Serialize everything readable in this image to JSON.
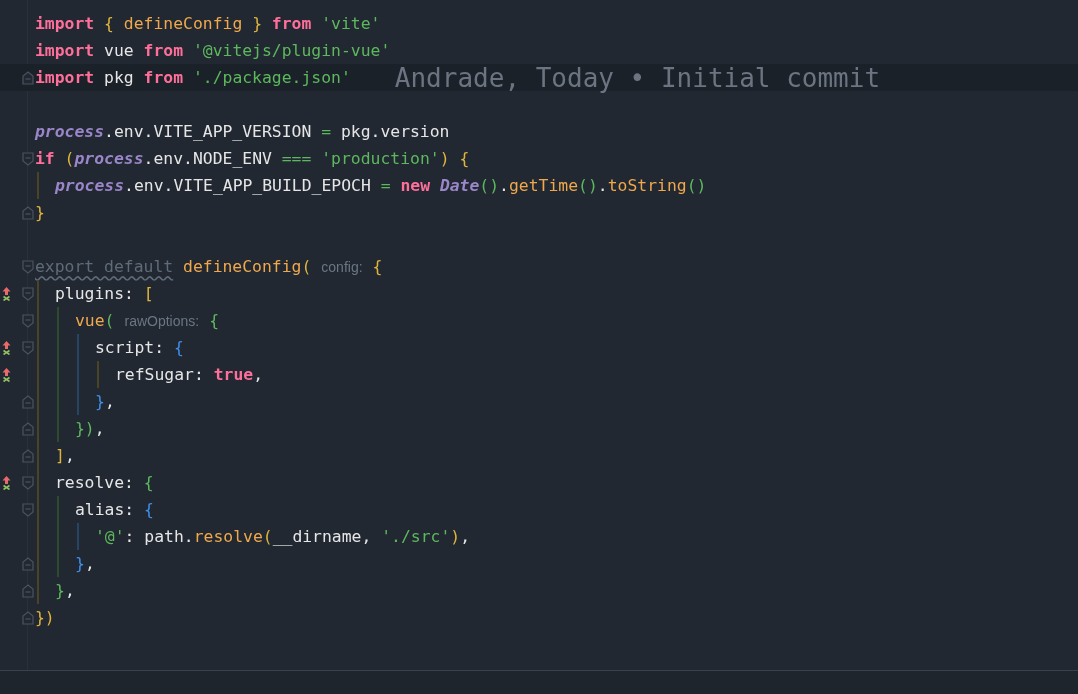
{
  "editor": {
    "lines": [
      {
        "kind": "code",
        "segments": [
          {
            "kind": "code",
            "tokens": [
              {
                "kind": "kw",
                "text": "import"
              },
              {
                "kind": "b1",
                "text": " {"
              },
              {
                "kind": "fn",
                "text": " defineConfig "
              },
              {
                "kind": "b1",
                "text": "}"
              },
              {
                "kind": "kw",
                "text": " from"
              },
              {
                "kind": "str",
                "text": " 'vite'"
              }
            ]
          }
        ]
      },
      {
        "kind": "code",
        "segments": [
          {
            "kind": "code",
            "tokens": [
              {
                "kind": "kw",
                "text": "import"
              },
              {
                "kind": "plain",
                "text": " vue "
              },
              {
                "kind": "kw",
                "text": "from"
              },
              {
                "kind": "str",
                "text": " '@vitejs/plugin-vue'"
              }
            ]
          }
        ]
      },
      {
        "kind": "code",
        "current": true,
        "fold_end": true,
        "blame": "Andrade, Today • Initial commit",
        "segments": [
          {
            "kind": "code",
            "tokens": [
              {
                "kind": "kw",
                "text": "import"
              },
              {
                "kind": "plain",
                "text": " pkg "
              },
              {
                "kind": "kw",
                "text": "from"
              },
              {
                "kind": "str",
                "text": " './package.json'"
              }
            ]
          }
        ]
      },
      {
        "kind": "blank"
      },
      {
        "kind": "code",
        "segments": [
          {
            "kind": "code",
            "tokens": [
              {
                "kind": "obj",
                "text": "process"
              },
              {
                "kind": "plain",
                "text": ".env.VITE_APP_VERSION "
              },
              {
                "kind": "op",
                "text": "="
              },
              {
                "kind": "plain",
                "text": " pkg.version"
              }
            ]
          }
        ]
      },
      {
        "kind": "code",
        "fold_start": true,
        "segments": [
          {
            "kind": "code",
            "tokens": [
              {
                "kind": "kw",
                "text": "if"
              },
              {
                "kind": "b1",
                "text": " ("
              },
              {
                "kind": "obj",
                "text": "process"
              },
              {
                "kind": "plain",
                "text": ".env.NODE_ENV "
              },
              {
                "kind": "op",
                "text": "==="
              },
              {
                "kind": "str",
                "text": " 'production'"
              },
              {
                "kind": "b1",
                "text": ")"
              },
              {
                "kind": "b1",
                "text": " {"
              }
            ]
          }
        ],
        "children": [
          {
            "kind": "code",
            "segments": [
              {
                "kind": "code",
                "tokens": [
                  {
                    "kind": "obj",
                    "text": "process"
                  },
                  {
                    "kind": "plain",
                    "text": ".env.VITE_APP_BUILD_EPOCH "
                  },
                  {
                    "kind": "op",
                    "text": "="
                  },
                  {
                    "kind": "kw",
                    "text": " new"
                  },
                  {
                    "kind": "obj",
                    "text": " Date"
                  },
                  {
                    "kind": "b2",
                    "text": "()"
                  },
                  {
                    "kind": "plain",
                    "text": "."
                  },
                  {
                    "kind": "fn",
                    "text": "getTime"
                  },
                  {
                    "kind": "b2",
                    "text": "()"
                  },
                  {
                    "kind": "plain",
                    "text": "."
                  },
                  {
                    "kind": "fn",
                    "text": "toString"
                  },
                  {
                    "kind": "b2",
                    "text": "()"
                  }
                ]
              }
            ]
          }
        ]
      },
      {
        "kind": "code",
        "fold_end": true,
        "segments": [
          {
            "kind": "code",
            "tokens": [
              {
                "kind": "b1",
                "text": "}"
              }
            ]
          }
        ]
      },
      {
        "kind": "blank"
      },
      {
        "kind": "code",
        "fold_start": true,
        "segments": [
          {
            "kind": "code",
            "tokens": [
              {
                "kind": "dim",
                "text": "export default"
              },
              {
                "kind": "fn",
                "text": " defineConfig"
              },
              {
                "kind": "b1",
                "text": "("
              }
            ]
          },
          {
            "kind": "hint",
            "text": "config:"
          },
          {
            "kind": "code",
            "tokens": [
              {
                "kind": "b1",
                "text": "{"
              }
            ]
          }
        ],
        "children": [
          {
            "kind": "code",
            "change": true,
            "fold_start": true,
            "segments": [
              {
                "kind": "code",
                "tokens": [
                  {
                    "kind": "plain",
                    "text": "plugins: "
                  },
                  {
                    "kind": "b1",
                    "text": "["
                  }
                ]
              }
            ],
            "children": [
              {
                "kind": "code",
                "fold_start": true,
                "segments": [
                  {
                    "kind": "code",
                    "tokens": [
                      {
                        "kind": "fn",
                        "text": "vue"
                      },
                      {
                        "kind": "b2",
                        "text": "("
                      }
                    ]
                  },
                  {
                    "kind": "hint",
                    "text": "rawOptions:"
                  },
                  {
                    "kind": "code",
                    "tokens": [
                      {
                        "kind": "b2",
                        "text": "{"
                      }
                    ]
                  }
                ],
                "children": [
                  {
                    "kind": "code",
                    "change": true,
                    "fold_start": true,
                    "segments": [
                      {
                        "kind": "code",
                        "tokens": [
                          {
                            "kind": "plain",
                            "text": "script: "
                          },
                          {
                            "kind": "b3",
                            "text": "{"
                          }
                        ]
                      }
                    ],
                    "children": [
                      {
                        "kind": "code",
                        "change": true,
                        "segments": [
                          {
                            "kind": "code",
                            "tokens": [
                              {
                                "kind": "plain",
                                "text": "refSugar: "
                              },
                              {
                                "kind": "kw",
                                "text": "true"
                              },
                              {
                                "kind": "plain",
                                "text": ","
                              }
                            ]
                          }
                        ]
                      }
                    ]
                  },
                  {
                    "kind": "code",
                    "fold_end": true,
                    "segments": [
                      {
                        "kind": "code",
                        "tokens": [
                          {
                            "kind": "b3",
                            "text": "}"
                          },
                          {
                            "kind": "plain",
                            "text": ","
                          }
                        ]
                      }
                    ]
                  }
                ]
              },
              {
                "kind": "code",
                "fold_end": true,
                "segments": [
                  {
                    "kind": "code",
                    "tokens": [
                      {
                        "kind": "b2",
                        "text": "})"
                      },
                      {
                        "kind": "plain",
                        "text": ","
                      }
                    ]
                  }
                ]
              }
            ]
          },
          {
            "kind": "code",
            "fold_end": true,
            "segments": [
              {
                "kind": "code",
                "tokens": [
                  {
                    "kind": "b1",
                    "text": "]"
                  },
                  {
                    "kind": "plain",
                    "text": ","
                  }
                ]
              }
            ]
          },
          {
            "kind": "code",
            "change": true,
            "fold_start": true,
            "segments": [
              {
                "kind": "code",
                "tokens": [
                  {
                    "kind": "plain",
                    "text": "resolve: "
                  },
                  {
                    "kind": "b2",
                    "text": "{"
                  }
                ]
              }
            ],
            "children": [
              {
                "kind": "code",
                "fold_start": true,
                "segments": [
                  {
                    "kind": "code",
                    "tokens": [
                      {
                        "kind": "plain",
                        "text": "alias: "
                      },
                      {
                        "kind": "b3",
                        "text": "{"
                      }
                    ]
                  }
                ],
                "children": [
                  {
                    "kind": "code",
                    "segments": [
                      {
                        "kind": "code",
                        "tokens": [
                          {
                            "kind": "str",
                            "text": "'@'"
                          },
                          {
                            "kind": "plain",
                            "text": ": path."
                          },
                          {
                            "kind": "fn",
                            "text": "resolve"
                          },
                          {
                            "kind": "b1",
                            "text": "("
                          },
                          {
                            "kind": "plain",
                            "text": "__dirname, "
                          },
                          {
                            "kind": "str",
                            "text": "'./src'"
                          },
                          {
                            "kind": "b1",
                            "text": ")"
                          },
                          {
                            "kind": "plain",
                            "text": ","
                          }
                        ]
                      }
                    ]
                  }
                ]
              },
              {
                "kind": "code",
                "fold_end": true,
                "segments": [
                  {
                    "kind": "code",
                    "tokens": [
                      {
                        "kind": "b3",
                        "text": "}"
                      },
                      {
                        "kind": "plain",
                        "text": ","
                      }
                    ]
                  }
                ]
              }
            ]
          },
          {
            "kind": "code",
            "fold_end": true,
            "segments": [
              {
                "kind": "code",
                "tokens": [
                  {
                    "kind": "b2",
                    "text": "}"
                  },
                  {
                    "kind": "plain",
                    "text": ","
                  }
                ]
              }
            ]
          }
        ]
      },
      {
        "kind": "code",
        "fold_end": true,
        "segments": [
          {
            "kind": "code",
            "tokens": [
              {
                "kind": "b1",
                "text": "})"
              }
            ]
          }
        ]
      }
    ]
  }
}
